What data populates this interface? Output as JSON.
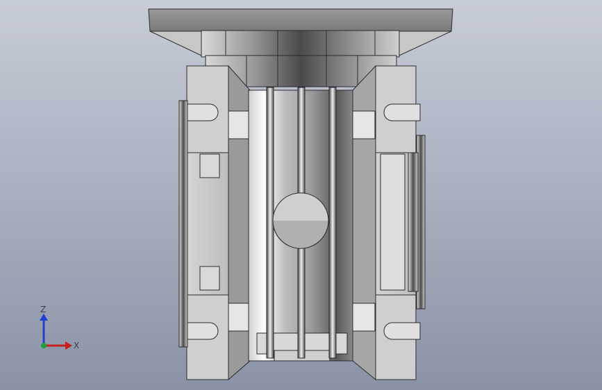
{
  "viewport": {
    "background_top": "#c7ccd6",
    "background_bottom": "#8a93a6"
  },
  "model": {
    "description_icon": "gear-reducer-3d-model",
    "metal_light": "#e8e8e8",
    "metal_mid": "#b8b8b8",
    "metal_dark": "#6e6e6e",
    "edge_color": "#2b2b2b"
  },
  "triad": {
    "z_label": "Z",
    "x_label": "X",
    "z_color": "#1f3fd0",
    "x_color": "#c81e1e",
    "origin_color": "#20a040"
  }
}
